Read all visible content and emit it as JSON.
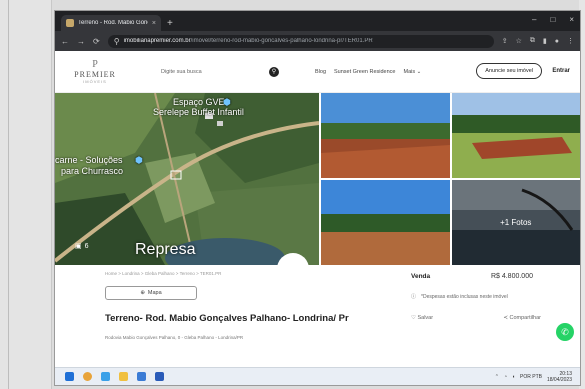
{
  "browser": {
    "tab_title": "Terreno - Rod. Mabio Gonçalves...",
    "tab_close": "×",
    "new_tab": "+",
    "url_domain": "imobiliariapremier.com.br",
    "url_path": "/imovel/terreno-rod-mabio-goncalves-palhano-londrina-pr/TER01.PR",
    "window_min": "–",
    "window_max": "□",
    "window_close": "×"
  },
  "site": {
    "logo_mark": "P",
    "logo_name": "PREMIER",
    "logo_sub": "IMÓVEIS",
    "search_placeholder": "Digite sua busca",
    "nav": [
      "Blog",
      "Sunset Green Residence",
      "Mais"
    ],
    "cta": "Anuncie seu imóvel",
    "login": "Entrar"
  },
  "gallery": {
    "map_labels": {
      "espaco": "Espaço GVE -",
      "serelepe": "Serelepe Buffet Infantil",
      "carne": "carne - Soluções",
      "churrasco": "para Churrasco"
    },
    "represa": "Represa",
    "photo_count": "6",
    "more_photos": "+1 Fotos"
  },
  "details": {
    "breadcrumb": "Home  >  Londrina  >  Gleba Palhano  >  Terreno  >  TER01.PR",
    "map_button": "Mapa",
    "title": "Terreno- Rod. Mabio Gonçalves Palhano- Londrina/ Pr",
    "address": "Rodovia Mabio Gonçalves Palhano, 0 - Gleba Palhano - Londrina/PR",
    "price_label": "Venda",
    "price_value": "R$ 4.800.000",
    "price_note": "*Despesas estão inclusas neste imóvel",
    "save": "Salvar",
    "share": "Compartilhar"
  },
  "taskbar": {
    "language": "POR PTB",
    "time": "20:13",
    "date": "18/04/2023"
  }
}
